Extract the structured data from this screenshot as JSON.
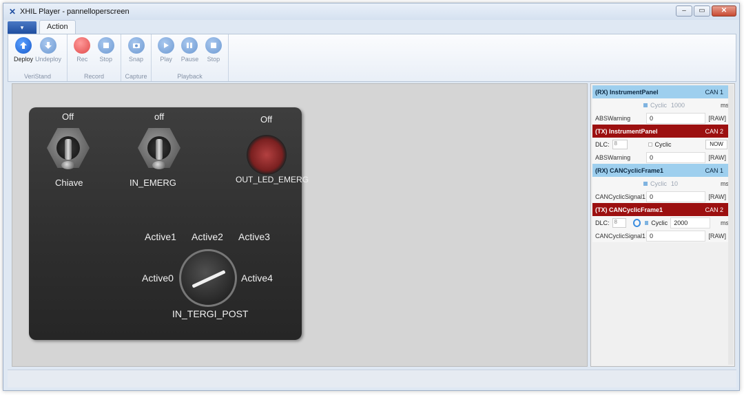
{
  "window": {
    "title": "XHIL Player - pannelloperscreen",
    "icon": "xhil-logo-icon"
  },
  "ribbon": {
    "tab": "Action",
    "groups": [
      {
        "label": "VeriStand",
        "buttons": [
          {
            "label": "Deploy",
            "icon": "upload-arrow-icon"
          },
          {
            "label": "Undeploy",
            "icon": "download-arrow-icon"
          }
        ]
      },
      {
        "label": "Record",
        "buttons": [
          {
            "label": "Rec",
            "icon": "record-icon"
          },
          {
            "label": "Stop",
            "icon": "stop-icon"
          }
        ]
      },
      {
        "label": "Capture",
        "buttons": [
          {
            "label": "Snap",
            "icon": "camera-icon"
          }
        ]
      },
      {
        "label": "Playback",
        "buttons": [
          {
            "label": "Play",
            "icon": "play-icon"
          },
          {
            "label": "Pause",
            "icon": "pause-icon"
          },
          {
            "label": "Stop",
            "icon": "stop-icon"
          }
        ]
      }
    ]
  },
  "panel": {
    "chiave": {
      "state": "Off",
      "label": "Chiave"
    },
    "in_emerg": {
      "state": "off",
      "label": "IN_EMERG"
    },
    "out_led": {
      "state": "Off",
      "label": "OUT_LED_EMERG"
    },
    "selector": {
      "label": "IN_TERGI_POST",
      "positions": [
        "Active0",
        "Active1",
        "Active2",
        "Active3",
        "Active4"
      ]
    }
  },
  "signals": [
    {
      "kind": "rx",
      "name": "(RX) InstrumentPanel",
      "bus": "CAN 1",
      "cyclic_label": "Cyclic",
      "period": "1000",
      "unit": "ms",
      "signal": "ABSWarning",
      "value": "0",
      "fmt": "[RAW]"
    },
    {
      "kind": "tx",
      "name": "(TX) InstrumentPanel",
      "bus": "CAN 2",
      "dlc_label": "DLC:",
      "dlc": "8",
      "cyclic_label": "Cyclic",
      "send": "NOW",
      "signal": "ABSWarning",
      "value": "0",
      "fmt": "[RAW]"
    },
    {
      "kind": "rx",
      "name": "(RX) CANCyclicFrame1",
      "bus": "CAN 1",
      "cyclic_label": "Cyclic",
      "period": "10",
      "unit": "ms",
      "signal": "CANCyclicSignal1",
      "value": "0",
      "fmt": "[RAW]"
    },
    {
      "kind": "tx",
      "name": "(TX) CANCyclicFrame1",
      "bus": "CAN 2",
      "dlc_label": "DLC:",
      "dlc": "8",
      "cyclic_label": "Cyclic",
      "period": "2000",
      "unit": "ms",
      "signal": "CANCyclicSignal1",
      "value": "0",
      "fmt": "[RAW]"
    }
  ]
}
